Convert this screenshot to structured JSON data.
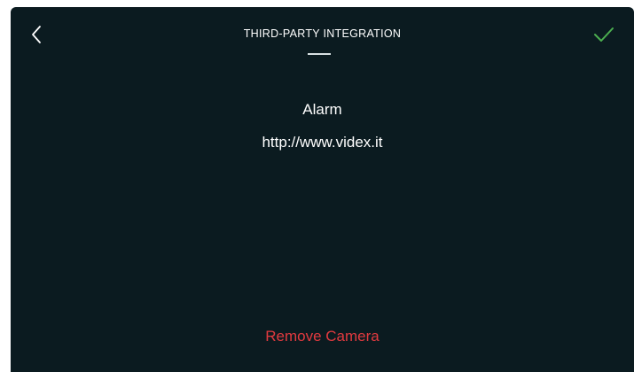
{
  "header": {
    "title": "THIRD-PARTY INTEGRATION",
    "back_icon": "chevron-left-icon",
    "confirm_icon": "checkmark-icon"
  },
  "integration": {
    "name": "Alarm",
    "url": "http://www.videx.it"
  },
  "actions": {
    "remove_label": "Remove Camera"
  },
  "colors": {
    "background": "#0b1b20",
    "text": "#ffffff",
    "confirm": "#4caf50",
    "danger": "#e23a3f"
  }
}
